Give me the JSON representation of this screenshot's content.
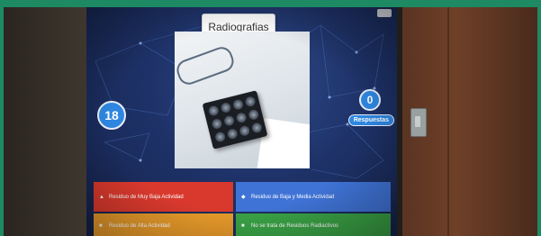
{
  "slide": {
    "title": "Radiografias",
    "counter": "18",
    "responses_count": "0",
    "responses_label": "Respuestas"
  },
  "answers": [
    {
      "symbol": "▲",
      "label": "Residuo de Muy Baja Actividad",
      "color": "#d9392d"
    },
    {
      "symbol": "◆",
      "label": "Residuo de Baja y Media Actividad",
      "color": "#3f73d6"
    },
    {
      "symbol": "■",
      "label": "Residuo de Alta Actividad",
      "color": "#e79a2a"
    },
    {
      "symbol": "■",
      "label": "No se trata de Residuos Radiactivos",
      "color": "#3aa346"
    }
  ]
}
